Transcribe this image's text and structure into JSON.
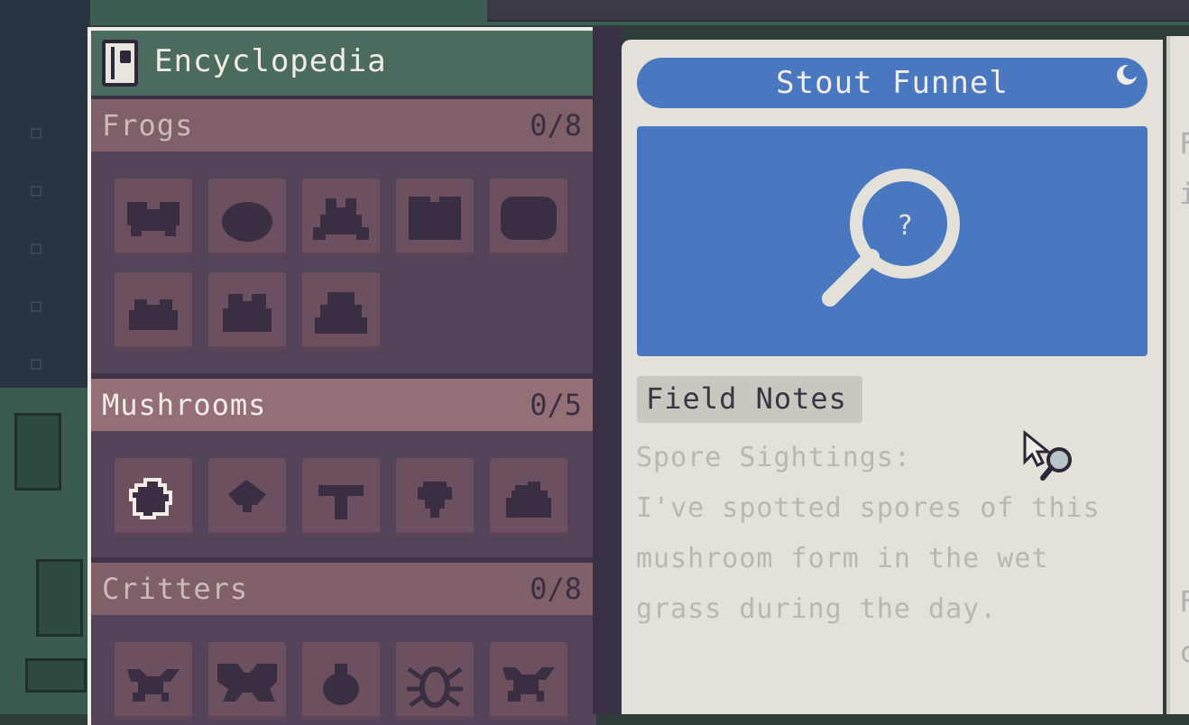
{
  "panel": {
    "title": "Encyclopedia",
    "icon": "book-icon"
  },
  "categories": [
    {
      "name": "Frogs",
      "count": "0/8",
      "slots": 8,
      "active": false
    },
    {
      "name": "Mushrooms",
      "count": "0/5",
      "slots": 5,
      "active": true
    },
    {
      "name": "Critters",
      "count": "0/8",
      "slots": 8,
      "active": false
    }
  ],
  "detail": {
    "title": "Stout Funnel",
    "image_icon": "magnifier-question-icon",
    "image_glyph": "?",
    "tab_label": "Field Notes",
    "notes_heading": "Spore Sightings:",
    "notes_lines": [
      "I've spotted spores of this",
      "mushroom form in the wet",
      "grass during the day."
    ]
  },
  "right_page_fragments": [
    "F",
    "i",
    "F",
    "c"
  ],
  "colors": {
    "header_green": "#4a6b5d",
    "accent_blue": "#4a78c0",
    "panel_purple": "#54445a",
    "category_bar": "#806068",
    "page": "#e4e0da"
  }
}
